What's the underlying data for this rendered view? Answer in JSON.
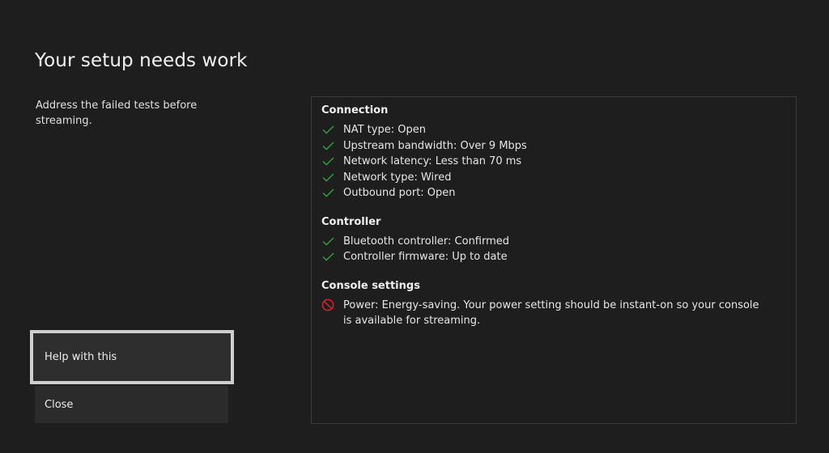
{
  "colors": {
    "background": "#1e1e1e",
    "pass": "#2fa33a",
    "fail": "#d3202a",
    "focus_border": "#cfcfcf"
  },
  "page": {
    "title": "Your setup needs work",
    "subtitle": "Address the failed tests before streaming."
  },
  "buttons": {
    "help_label": "Help with this",
    "close_label": "Close"
  },
  "sections": {
    "connection": {
      "title": "Connection",
      "items": [
        {
          "text": "NAT type: Open",
          "status": "pass",
          "icon": "check-icon"
        },
        {
          "text": "Upstream bandwidth: Over 9 Mbps",
          "status": "pass",
          "icon": "check-icon"
        },
        {
          "text": "Network latency: Less than 70 ms",
          "status": "pass",
          "icon": "check-icon"
        },
        {
          "text": "Network type: Wired",
          "status": "pass",
          "icon": "check-icon"
        },
        {
          "text": "Outbound port: Open",
          "status": "pass",
          "icon": "check-icon"
        }
      ]
    },
    "controller": {
      "title": "Controller",
      "items": [
        {
          "text": "Bluetooth controller: Confirmed",
          "status": "pass",
          "icon": "check-icon"
        },
        {
          "text": "Controller firmware: Up to date",
          "status": "pass",
          "icon": "check-icon"
        }
      ]
    },
    "console": {
      "title": "Console settings",
      "items": [
        {
          "text": "Power: Energy-saving. Your power setting should be instant-on so your console is available for streaming.",
          "status": "fail",
          "icon": "prohibited-icon"
        }
      ]
    }
  }
}
